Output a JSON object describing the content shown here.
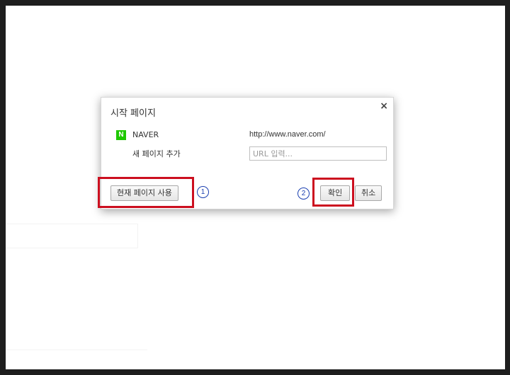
{
  "dialog": {
    "title": "시작 페이지",
    "close_label": "×",
    "entries": [
      {
        "icon": "naver-logo-icon",
        "logo_text": "N",
        "name": "NAVER",
        "url": "http://www.naver.com/"
      }
    ],
    "add_page": {
      "label": "새 페이지 추가",
      "placeholder": "URL 입력..."
    },
    "buttons": {
      "use_current": "현재 페이지 사용",
      "ok": "확인",
      "cancel": "취소"
    }
  },
  "annotations": {
    "marker_1": "1",
    "marker_2": "2",
    "highlight_color": "#cc0f1f",
    "marker_color": "#1a3fb0"
  },
  "colors": {
    "naver_green": "#1ec800"
  }
}
